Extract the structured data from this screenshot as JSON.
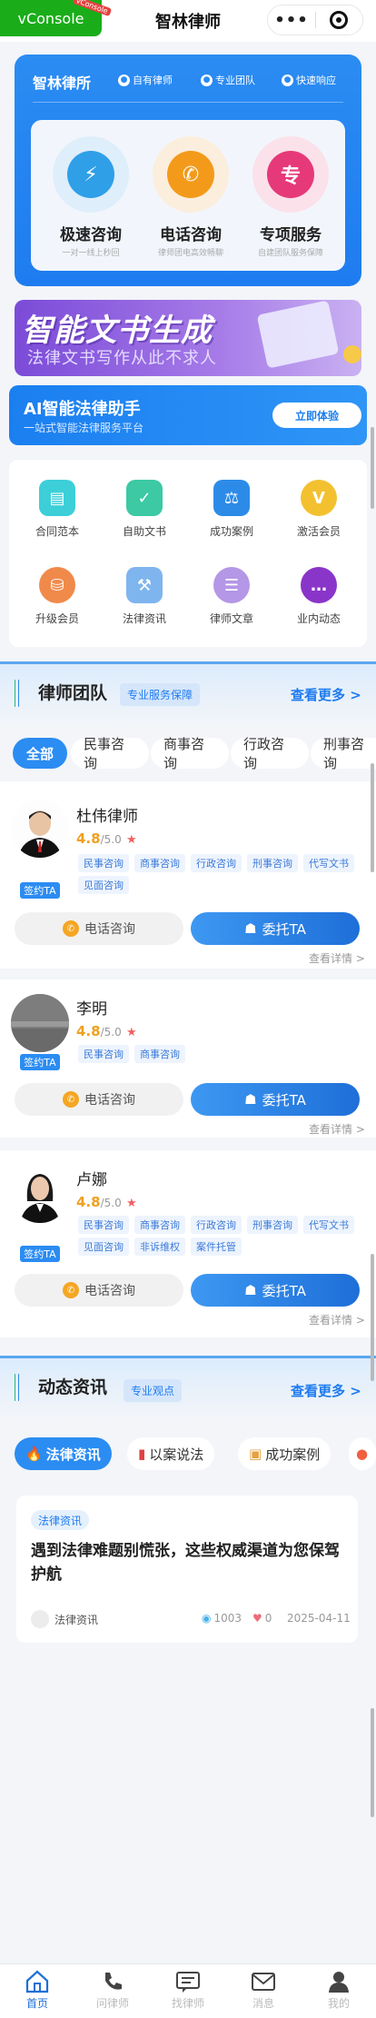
{
  "vconsole": {
    "label": "vConsole",
    "tag": "vConsole"
  },
  "header": {
    "title": "智林律师"
  },
  "hero": {
    "title": "智林律所",
    "features": [
      "自有律师",
      "专业团队",
      "快速响应"
    ],
    "services": [
      {
        "title": "极速咨询",
        "subtitle": "一对一线上秒回",
        "icon": "bolt-icon",
        "color": "#2f9fe8"
      },
      {
        "title": "电话咨询",
        "subtitle": "律师团电高效畅聊",
        "icon": "phone-icon",
        "color": "#f39a1a"
      },
      {
        "title": "专项服务",
        "subtitle": "自建团队服务保障",
        "icon": "专",
        "color": "#e6397a"
      }
    ]
  },
  "banner": {
    "title": "智能文书生成",
    "subtitle": "法律文书写作从此不求人"
  },
  "ai": {
    "title": "AI智能法律助手",
    "subtitle": "一站式智能法律服务平台",
    "button": "立即体验"
  },
  "menu": [
    {
      "label": "合同范本",
      "icon": "contract-icon",
      "color": "#3ccfd8"
    },
    {
      "label": "自助文书",
      "icon": "document-icon",
      "color": "#3cc9a4"
    },
    {
      "label": "成功案例",
      "icon": "gavel-icon",
      "color": "#2d8be8"
    },
    {
      "label": "激活会员",
      "icon": "vip-icon",
      "color": "#f3c12f"
    },
    {
      "label": "升级会员",
      "icon": "basket-icon",
      "color": "#f08a4b"
    },
    {
      "label": "法律资讯",
      "icon": "law-news-icon",
      "color": "#7fb5ee"
    },
    {
      "label": "律师文章",
      "icon": "article-icon",
      "color": "#b497e6"
    },
    {
      "label": "业内动态",
      "icon": "chat-icon",
      "color": "#8a35c9"
    }
  ],
  "team": {
    "title": "律师团队",
    "tag": "专业服务保障",
    "more": "查看更多 >",
    "tabs": [
      "全部",
      "民事咨询",
      "商事咨询",
      "行政咨询",
      "刑事咨询"
    ],
    "sign_label": "签约TA",
    "call_label": "电话咨询",
    "hire_label": "委托TA",
    "detail_label": "查看详情 >",
    "rating_suffix": "/5.0",
    "lawyers": [
      {
        "name": "杜伟律师",
        "rating": "4.8",
        "tags": [
          "民事咨询",
          "商事咨询",
          "行政咨询",
          "刑事咨询",
          "代写文书",
          "见面咨询"
        ]
      },
      {
        "name": "李明",
        "rating": "4.8",
        "tags": [
          "民事咨询",
          "商事咨询"
        ]
      },
      {
        "name": "卢娜",
        "rating": "4.8",
        "tags": [
          "民事咨询",
          "商事咨询",
          "行政咨询",
          "刑事咨询",
          "代写文书",
          "见面咨询",
          "非诉维权",
          "案件托管"
        ]
      }
    ]
  },
  "news": {
    "title": "动态资讯",
    "tag": "专业观点",
    "more": "查看更多 >",
    "tabs": [
      "法律资讯",
      "以案说法",
      "成功案例"
    ],
    "article": {
      "badge": "法律资讯",
      "title": "遇到法律难题别慌张，这些权威渠道为您保驾护航",
      "source": "法律资讯",
      "views": "1003",
      "likes": "0",
      "date": "2025-04-11"
    }
  },
  "tabbar": [
    {
      "label": "首页",
      "icon": "home-icon",
      "active": true
    },
    {
      "label": "问律师",
      "icon": "phone-icon",
      "active": false
    },
    {
      "label": "找律师",
      "icon": "message-icon",
      "active": false
    },
    {
      "label": "消息",
      "icon": "mail-icon",
      "active": false
    },
    {
      "label": "我的",
      "icon": "user-icon",
      "active": false
    }
  ]
}
